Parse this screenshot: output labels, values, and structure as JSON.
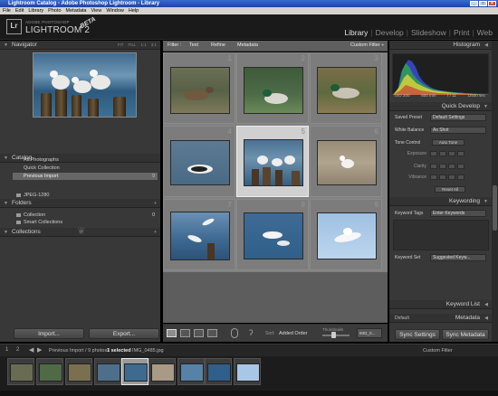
{
  "window": {
    "title": "Lightroom Catalog - Adobe Photoshop Lightroom - Library"
  },
  "menu": [
    "File",
    "Edit",
    "Library",
    "Photo",
    "Metadata",
    "View",
    "Window",
    "Help"
  ],
  "header": {
    "logo": "Lr",
    "brand_small": "ADOBE PHOTOSHOP",
    "brand_big": "LIGHTROOM 2",
    "beta": "BETA",
    "modules": [
      "Library",
      "Develop",
      "Slideshow",
      "Print",
      "Web"
    ],
    "active_module": "Library"
  },
  "left": {
    "navigator": {
      "title": "Navigator",
      "modes": [
        "FIT",
        "FILL",
        "1:1",
        "3:1"
      ]
    },
    "catalog": {
      "title": "Catalog",
      "items": [
        {
          "label": "All Photographs",
          "count": ""
        },
        {
          "label": "Quick Collection",
          "count": ""
        },
        {
          "label": "Previous Import",
          "count": "9"
        }
      ]
    },
    "folders": {
      "title": "Folders",
      "items": [
        "JPEG-1280"
      ]
    },
    "collections": {
      "title": "Collections",
      "items": [
        "Collection",
        "Smart Collections"
      ],
      "collection_count": "0"
    },
    "import_label": "Import...",
    "export_label": "Export..."
  },
  "filter_bar": {
    "label": "Filter :",
    "tabs": [
      "Text",
      "Refine",
      "Metadata"
    ],
    "custom": "Custom Filter ÷"
  },
  "grid": {
    "cells": [
      {
        "index": "1",
        "scene": "duck-brown"
      },
      {
        "index": "2",
        "scene": "mallard"
      },
      {
        "index": "3",
        "scene": "mallard-grass"
      },
      {
        "index": "4",
        "scene": "longtail-duck"
      },
      {
        "index": "5",
        "scene": "gulls-posts",
        "selected": true
      },
      {
        "index": "6",
        "scene": "gull-sand"
      },
      {
        "index": "7",
        "scene": "gulls-flying"
      },
      {
        "index": "8",
        "scene": "gull-water"
      },
      {
        "index": "9",
        "scene": "gull-sky"
      }
    ]
  },
  "toolbar": {
    "sort_label": "Sort:",
    "sort_value": "Added Order",
    "thumbnails_label": "Thumbnails",
    "filename_chip": "IMG_0..."
  },
  "right": {
    "histogram": {
      "title": "Histogram",
      "iso": "ISO 200",
      "focal": "600 mm",
      "aperture": "f / 11",
      "shutter": "1/500 sec"
    },
    "quick_develop": {
      "title": "Quick Develop",
      "saved_preset_label": "Saved Preset",
      "saved_preset_value": "Default Settings",
      "white_balance_label": "White Balance",
      "white_balance_value": "As Shot",
      "tone_control_label": "Tone Control",
      "auto_tone": "Auto Tone",
      "adjustments": [
        "Exposure",
        "Clarity",
        "Vibrance"
      ],
      "reset": "Reset All"
    },
    "keywording": {
      "title": "Keywording",
      "tags_label": "Keyword Tags",
      "tags_value": "Enter Keywords",
      "set_label": "Keyword Set",
      "set_value": "Suggested Keyw..."
    },
    "keyword_list": {
      "title": "Keyword List"
    },
    "metadata": {
      "title": "Metadata",
      "preset": "Default"
    },
    "sync_settings": "Sync Settings",
    "sync_metadata": "Sync Metadata"
  },
  "filmstrip": {
    "path": "Previous Import / 9 photos /",
    "selected": "1 selected",
    "filename": "/ IMG_0485.jpg",
    "filter_label": "Custom Filter",
    "page_left": "1",
    "page_right": "2"
  }
}
